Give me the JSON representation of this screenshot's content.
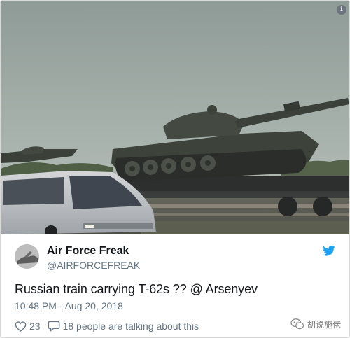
{
  "tweet": {
    "display_name": "Air Force Freak",
    "handle": "@AIRFORCEFREAK",
    "text": "Russian train carrying T-62s ?? @ Arsenyev",
    "timestamp": "10:48 PM - Aug 20, 2018",
    "likes": "23",
    "talking": "18 people are talking about this"
  },
  "watermark": {
    "text": "胡说施佬"
  },
  "icons": {
    "info": "info-icon",
    "brand": "twitter-bird-icon",
    "like": "heart-icon",
    "reply": "speech-bubble-icon",
    "watermark": "wechat-logo-icon"
  },
  "colors": {
    "twitter_blue": "#1da1f2",
    "text": "#14171a",
    "muted": "#657786"
  }
}
